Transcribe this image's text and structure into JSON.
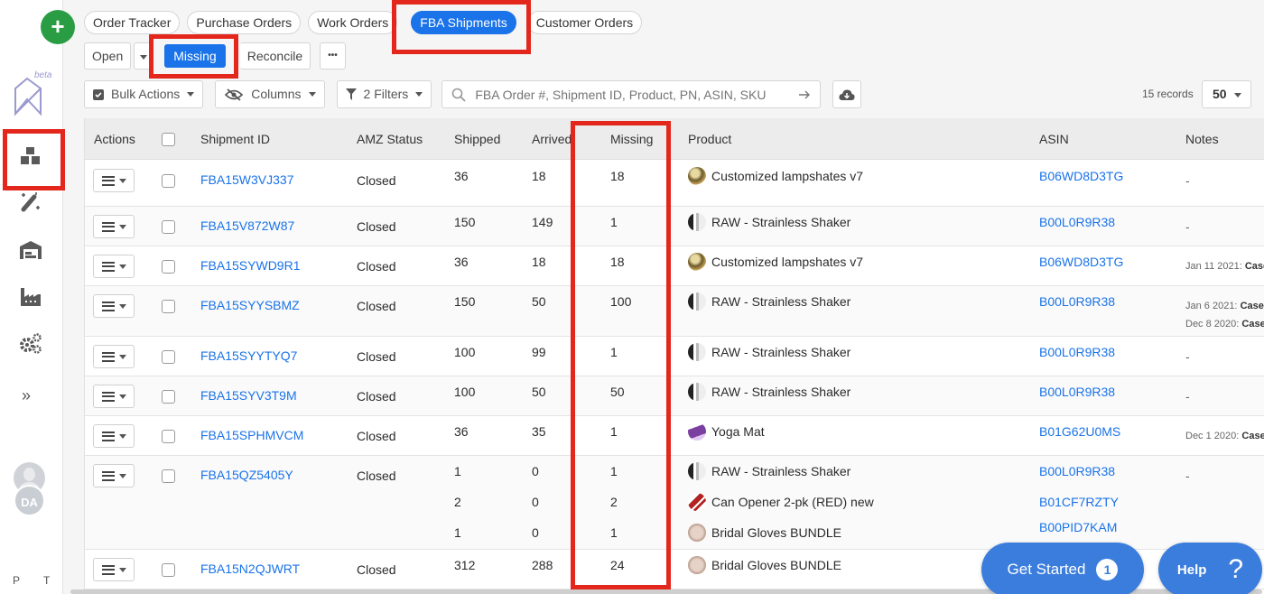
{
  "sidebar": {
    "add_label": "+",
    "beta_label": "beta",
    "items": [
      {
        "icon": "inventory-boxes-icon",
        "active": true
      },
      {
        "icon": "magic-wand-icon"
      },
      {
        "icon": "warehouse-icon"
      },
      {
        "icon": "factory-icon"
      },
      {
        "icon": "settings-gears-icon"
      }
    ],
    "expand_label": "»",
    "user_initials": "DA",
    "footer_left": "P",
    "footer_right": "T"
  },
  "tabs": [
    {
      "label": "Order Tracker",
      "active": false
    },
    {
      "label": "Purchase Orders",
      "active": false
    },
    {
      "label": "Work Orders",
      "active": false
    },
    {
      "label": "FBA Shipments",
      "active": true
    },
    {
      "label": "Customer Orders",
      "active": false
    }
  ],
  "status_toolbar": {
    "open_label": "Open",
    "missing_label": "Missing",
    "reconcile_label": "Reconcile",
    "more_label": "•••"
  },
  "filter_toolbar": {
    "bulk_actions_label": "Bulk Actions",
    "columns_label": "Columns",
    "filters_label": "2 Filters",
    "search_placeholder": "FBA Order #, Shipment ID, Product, PN, ASIN, SKU",
    "records_label": "15 records",
    "per_page": "50"
  },
  "table": {
    "columns": [
      "Actions",
      "",
      "Shipment ID",
      "AMZ Status",
      "Shipped",
      "Arrived",
      "Missing",
      "Product",
      "ASIN",
      "Notes"
    ],
    "rows": [
      {
        "id": "FBA15W3VJ337",
        "status": "Closed",
        "lines": [
          {
            "shipped": "36",
            "arrived": "18",
            "missing": "18",
            "product": "Customized lampshates v7",
            "thumb": "lamp",
            "asin": "B06WD8D3TG"
          }
        ],
        "notes": [
          {
            "text": "-"
          }
        ]
      },
      {
        "id": "FBA15V872W87",
        "status": "Closed",
        "lines": [
          {
            "shipped": "150",
            "arrived": "149",
            "missing": "1",
            "product": "RAW - Strainless Shaker",
            "thumb": "shaker",
            "asin": "B00L0R9R38"
          }
        ],
        "notes": [
          {
            "text": "-"
          }
        ]
      },
      {
        "id": "FBA15SYWD9R1",
        "status": "Closed",
        "lines": [
          {
            "shipped": "36",
            "arrived": "18",
            "missing": "18",
            "product": "Customized lampshates v7",
            "thumb": "lamp",
            "asin": "B06WD8D3TG"
          }
        ],
        "notes": [
          {
            "date": "Jan 11 2021:",
            "text": "Case"
          }
        ]
      },
      {
        "id": "FBA15SYYSBMZ",
        "status": "Closed",
        "lines": [
          {
            "shipped": "150",
            "arrived": "50",
            "missing": "100",
            "product": "RAW - Strainless Shaker",
            "thumb": "shaker",
            "asin": "B00L0R9R38"
          }
        ],
        "notes": [
          {
            "date": "Jan 6 2021:",
            "text": "Case"
          },
          {
            "date": "Dec 8 2020:",
            "text": "Case"
          }
        ]
      },
      {
        "id": "FBA15SYYTYQ7",
        "status": "Closed",
        "lines": [
          {
            "shipped": "100",
            "arrived": "99",
            "missing": "1",
            "product": "RAW - Strainless Shaker",
            "thumb": "shaker",
            "asin": "B00L0R9R38"
          }
        ],
        "notes": [
          {
            "text": "-"
          }
        ]
      },
      {
        "id": "FBA15SYV3T9M",
        "status": "Closed",
        "lines": [
          {
            "shipped": "100",
            "arrived": "50",
            "missing": "50",
            "product": "RAW - Strainless Shaker",
            "thumb": "shaker",
            "asin": "B00L0R9R38"
          }
        ],
        "notes": [
          {
            "text": "-"
          }
        ]
      },
      {
        "id": "FBA15SPHMVCM",
        "status": "Closed",
        "lines": [
          {
            "shipped": "36",
            "arrived": "35",
            "missing": "1",
            "product": "Yoga Mat",
            "thumb": "yoga",
            "asin": "B01G62U0MS"
          }
        ],
        "notes": [
          {
            "date": "Dec 1 2020:",
            "text": "Case"
          }
        ]
      },
      {
        "id": "FBA15QZ5405Y",
        "status": "Closed",
        "lines": [
          {
            "shipped": "1",
            "arrived": "0",
            "missing": "1",
            "product": "RAW - Strainless Shaker",
            "thumb": "shaker",
            "asin": "B00L0R9R38"
          },
          {
            "shipped": "2",
            "arrived": "0",
            "missing": "2",
            "product": "Can Opener 2-pk (RED) new",
            "thumb": "opener",
            "asin": "B01CF7RZTY"
          },
          {
            "shipped": "1",
            "arrived": "0",
            "missing": "1",
            "product": "Bridal Gloves BUNDLE",
            "thumb": "gloves",
            "asin": "B00PID7KAM"
          }
        ],
        "notes": [
          {
            "text": "-"
          }
        ]
      },
      {
        "id": "FBA15N2QJWRT",
        "status": "Closed",
        "lines": [
          {
            "shipped": "312",
            "arrived": "288",
            "missing": "24",
            "product": "Bridal Gloves BUNDLE",
            "thumb": "gloves",
            "asin": ""
          }
        ],
        "notes": []
      }
    ]
  },
  "floating": {
    "get_started_label": "Get Started",
    "get_started_count": "1",
    "help_label": "Help",
    "help_icon": "?"
  },
  "colors": {
    "accent": "#1a73e8",
    "add_button": "#2a9d44",
    "highlight": "#e3271c",
    "floating_button": "#3b7ddd"
  }
}
